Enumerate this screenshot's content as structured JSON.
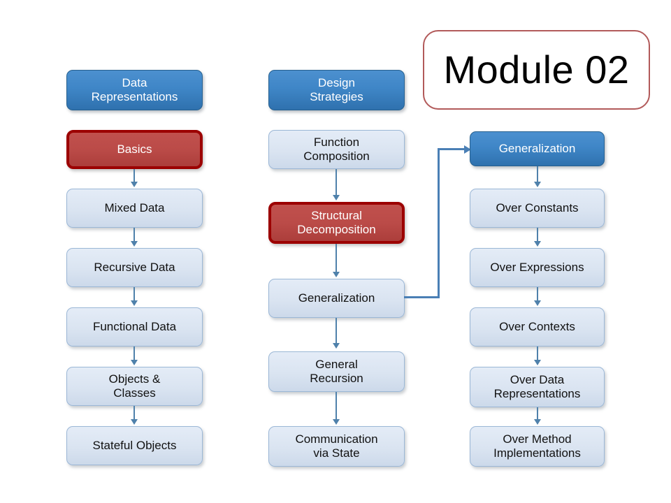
{
  "slide": {
    "title": "Module 02",
    "background_color": "#ffffff"
  },
  "colors": {
    "header_blue": "#3f86c7",
    "highlight_red": "#c0504d",
    "highlight_red_border": "#9c0000",
    "plain_blue": "#dae4f1",
    "plain_border": "#9bb7d6",
    "connector": "#4f81ab",
    "elbow_connector": "#4a7fb5",
    "title_border": "#b25a5a",
    "text_dark": "#111111",
    "text_light": "#ffffff"
  },
  "columns": [
    {
      "id": "data-representations",
      "header": "Data\nRepresentations",
      "nodes": [
        {
          "label": "Basics",
          "style": "highlight"
        },
        {
          "label": "Mixed Data",
          "style": "plain"
        },
        {
          "label": "Recursive Data",
          "style": "plain"
        },
        {
          "label": "Functional Data",
          "style": "plain"
        },
        {
          "label": "Objects &\nClasses",
          "style": "plain"
        },
        {
          "label": "Stateful Objects",
          "style": "plain"
        }
      ]
    },
    {
      "id": "design-strategies",
      "header": "Design\nStrategies",
      "nodes": [
        {
          "label": "Function\nComposition",
          "style": "plain"
        },
        {
          "label": "Structural\nDecomposition",
          "style": "highlight"
        },
        {
          "label": "Generalization",
          "style": "plain"
        },
        {
          "label": "General\nRecursion",
          "style": "plain"
        },
        {
          "label": "Communication\nvia State",
          "style": "plain"
        }
      ]
    },
    {
      "id": "generalization-detail",
      "header": "Generalization",
      "nodes": [
        {
          "label": "Over Constants",
          "style": "plain"
        },
        {
          "label": "Over Expressions",
          "style": "plain"
        },
        {
          "label": "Over Contexts",
          "style": "plain"
        },
        {
          "label": "Over Data\nRepresentations",
          "style": "plain"
        },
        {
          "label": "Over Method\nImplementations",
          "style": "plain"
        }
      ]
    }
  ],
  "cross_link": {
    "from": "design-strategies.generalization",
    "to": "generalization-detail.header",
    "icon": "arrow-right-icon"
  }
}
